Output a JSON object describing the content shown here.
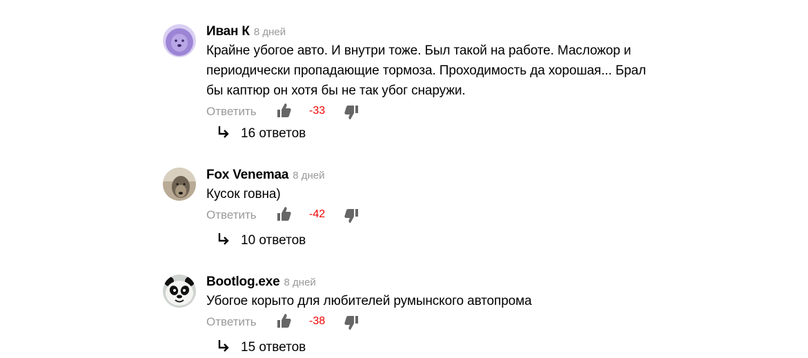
{
  "comments": [
    {
      "author": "Иван К",
      "time": "8 дней",
      "text": [
        "Крайне убогое авто. И внутри тоже. Был такой на работе. Масложор и",
        "периодически пропадающие тормоза. Проходимость да хорошая... Брал",
        "бы каптюр он хотя бы не так убог снаружи."
      ],
      "reply_label": "Ответить",
      "score": "-33",
      "replies_label": "16 ответов",
      "avatar_icon": "purple-lion-avatar"
    },
    {
      "author": "Fox Venemaa",
      "time": "8 дней",
      "text": [
        "Кусок говна)"
      ],
      "reply_label": "Ответить",
      "score": "-42",
      "replies_label": "10 ответов",
      "avatar_icon": "wolf-photo-avatar"
    },
    {
      "author": "Bootlog.exe",
      "time": "8 дней",
      "text": [
        "Убогое корыто для любителей румынского автопрома"
      ],
      "reply_label": "Ответить",
      "score": "-38",
      "replies_label": "15 ответов",
      "avatar_icon": "panda-avatar"
    }
  ],
  "colors": {
    "score": "#e00000",
    "muted": "#999999",
    "icon": "#666666",
    "avatar_purple": "#a78fd8"
  }
}
